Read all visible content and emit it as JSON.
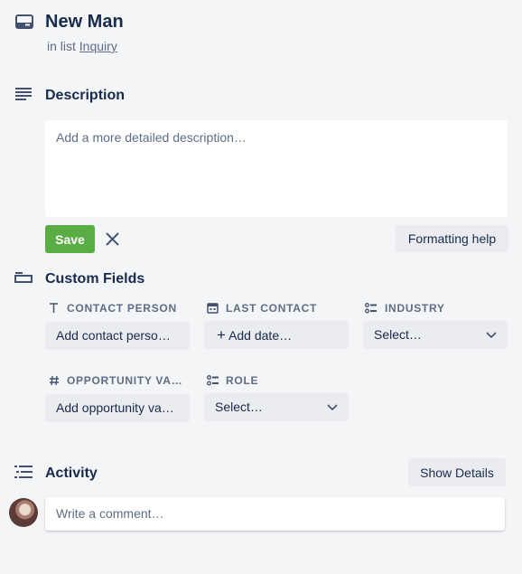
{
  "card": {
    "title": "New Man",
    "in_list_prefix": "in list",
    "list_name": "Inquiry"
  },
  "description": {
    "heading": "Description",
    "placeholder": "Add a more detailed description…",
    "save_label": "Save",
    "formatting_help_label": "Formatting help"
  },
  "custom_fields": {
    "heading": "Custom Fields",
    "fields": [
      {
        "label": "CONTACT PERSON",
        "value": "Add contact perso…"
      },
      {
        "label": "LAST CONTACT",
        "value": "Add date…"
      },
      {
        "label": "INDUSTRY",
        "value": "Select…"
      },
      {
        "label": "OPPORTUNITY VA…",
        "value": "Add opportunity va…"
      },
      {
        "label": "ROLE",
        "value": "Select…"
      }
    ]
  },
  "activity": {
    "heading": "Activity",
    "show_details_label": "Show Details",
    "comment_placeholder": "Write a comment…"
  },
  "colors": {
    "save_green": "#5aac44",
    "text": "#172b4d",
    "muted": "#5e6c84",
    "button_bg": "#ebecf0"
  },
  "icons": [
    "card-icon",
    "description-icon",
    "custom-fields-icon",
    "text-icon",
    "calendar-icon",
    "dropdown-field-icon",
    "number-icon",
    "activity-icon",
    "close-icon",
    "chevron-down-icon",
    "plus-icon"
  ]
}
